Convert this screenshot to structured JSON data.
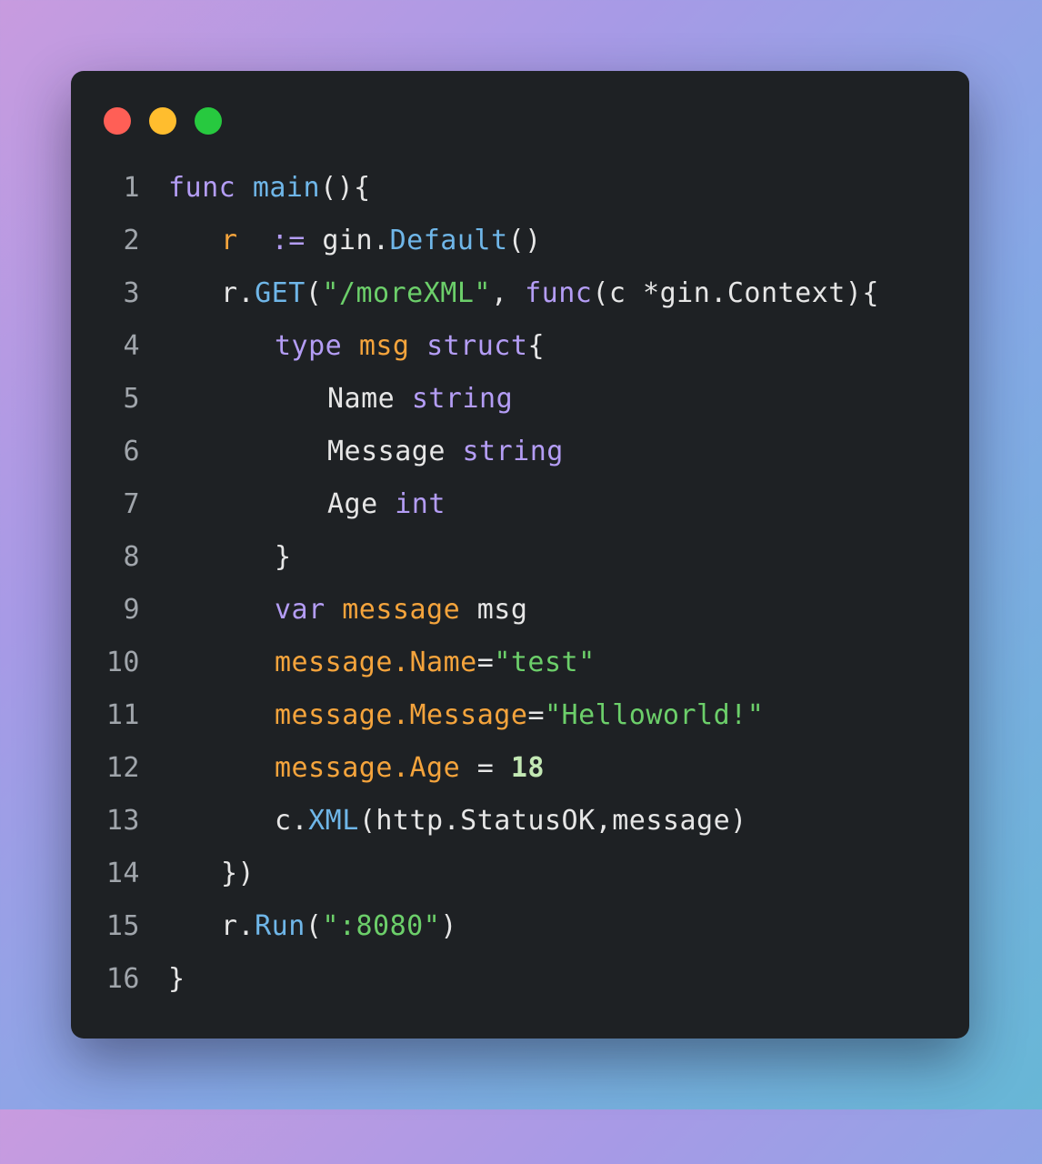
{
  "window": {
    "controls": [
      "close",
      "minimize",
      "maximize"
    ],
    "colors": {
      "close": "#ff5f56",
      "minimize": "#ffbd2e",
      "maximize": "#27c93f"
    }
  },
  "code": {
    "language": "go",
    "lines": [
      {
        "n": "1",
        "tokens": [
          "func",
          "main",
          "(){"
        ]
      },
      {
        "n": "2",
        "tokens": [
          "r",
          ":=",
          "gin.",
          "Default",
          "()"
        ]
      },
      {
        "n": "3",
        "tokens": [
          "r.",
          "GET",
          "(",
          "\"/moreXML\"",
          ", ",
          "func",
          "(c *gin.Context){"
        ]
      },
      {
        "n": "4",
        "tokens": [
          "type",
          "msg",
          "struct",
          "{"
        ]
      },
      {
        "n": "5",
        "tokens": [
          "Name",
          "string"
        ]
      },
      {
        "n": "6",
        "tokens": [
          "Message",
          "string"
        ]
      },
      {
        "n": "7",
        "tokens": [
          "Age",
          "int"
        ]
      },
      {
        "n": "8",
        "tokens": [
          "}"
        ]
      },
      {
        "n": "9",
        "tokens": [
          "var",
          "message",
          "msg"
        ]
      },
      {
        "n": "10",
        "tokens": [
          "message.Name",
          "=",
          "\"test\""
        ]
      },
      {
        "n": "11",
        "tokens": [
          "message.Message",
          "=",
          "\"Helloworld!\""
        ]
      },
      {
        "n": "12",
        "tokens": [
          "message.Age",
          " = ",
          "18"
        ]
      },
      {
        "n": "13",
        "tokens": [
          "c.",
          "XML",
          "(http.StatusOK,message)"
        ]
      },
      {
        "n": "14",
        "tokens": [
          "})"
        ]
      },
      {
        "n": "15",
        "tokens": [
          "r.",
          "Run",
          "(",
          "\":8080\"",
          ")"
        ]
      },
      {
        "n": "16",
        "tokens": [
          "}"
        ]
      }
    ]
  },
  "colors": {
    "keyword": "#b49df5",
    "function": "#6fb6e8",
    "variable": "#f5a43c",
    "string": "#6ccf6a",
    "number": "#c3e8b4",
    "text": "#e6e6e6",
    "line_number": "#a0a5ab",
    "window_bg": "#1e2124"
  }
}
